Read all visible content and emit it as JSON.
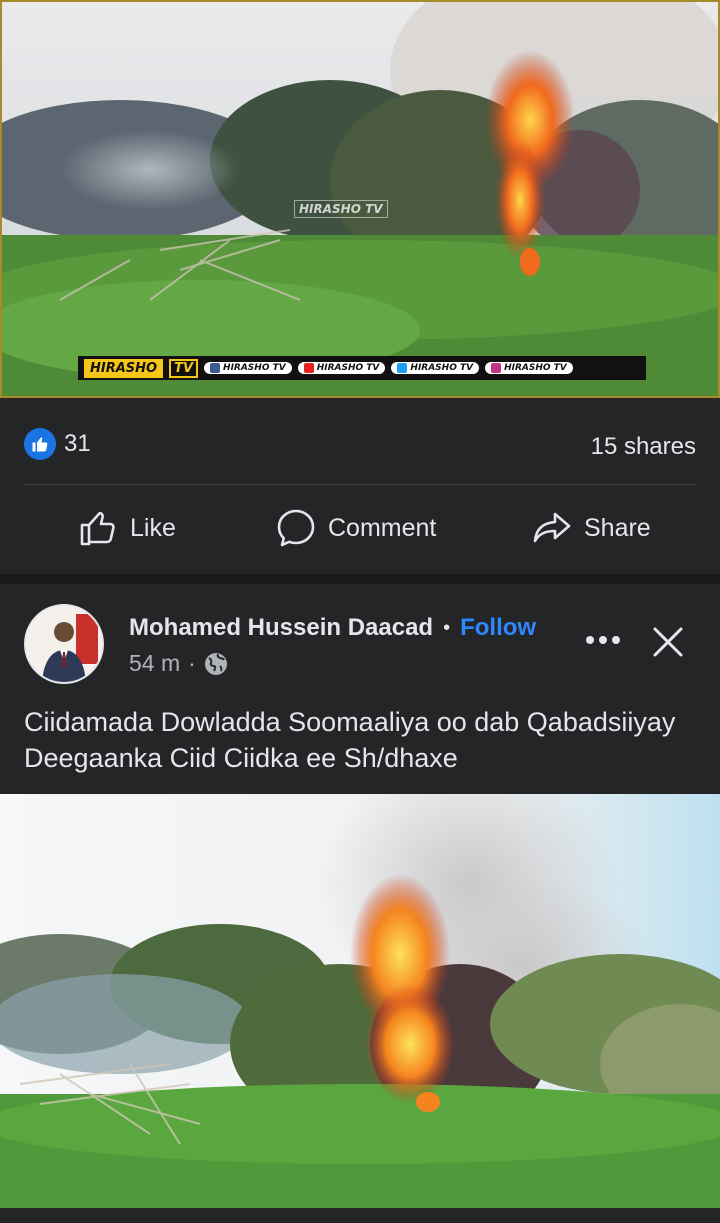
{
  "top_video": {
    "watermark_center": "HIRASHO TV",
    "watermark_brand": "HIRASHO",
    "watermark_tv": "TV",
    "social_chips": [
      "HIRASHO TV",
      "HIRASHO TV",
      "HIRASHO TV",
      "HIRASHO TV"
    ],
    "chip_colors": [
      "#3b5998",
      "#e62117",
      "#1da1f2",
      "#c13584"
    ]
  },
  "stats": {
    "reaction_count": "31",
    "shares": "15 shares"
  },
  "actions": {
    "like_label": "Like",
    "comment_label": "Comment",
    "share_label": "Share"
  },
  "post": {
    "author": "Mohamed Hussein Daacad",
    "separator": "•",
    "follow_label": "Follow",
    "time": "54 m",
    "meta_separator": "·",
    "text": "Ciidamada Dowladda Soomaaliya oo dab Qabadsiiyay Deegaanka Ciid Ciidka ee Sh/dhaxe"
  },
  "colors": {
    "background": "#18191a",
    "card": "#242526",
    "accent": "#2d88ff",
    "like_blue": "#1b74e4"
  }
}
